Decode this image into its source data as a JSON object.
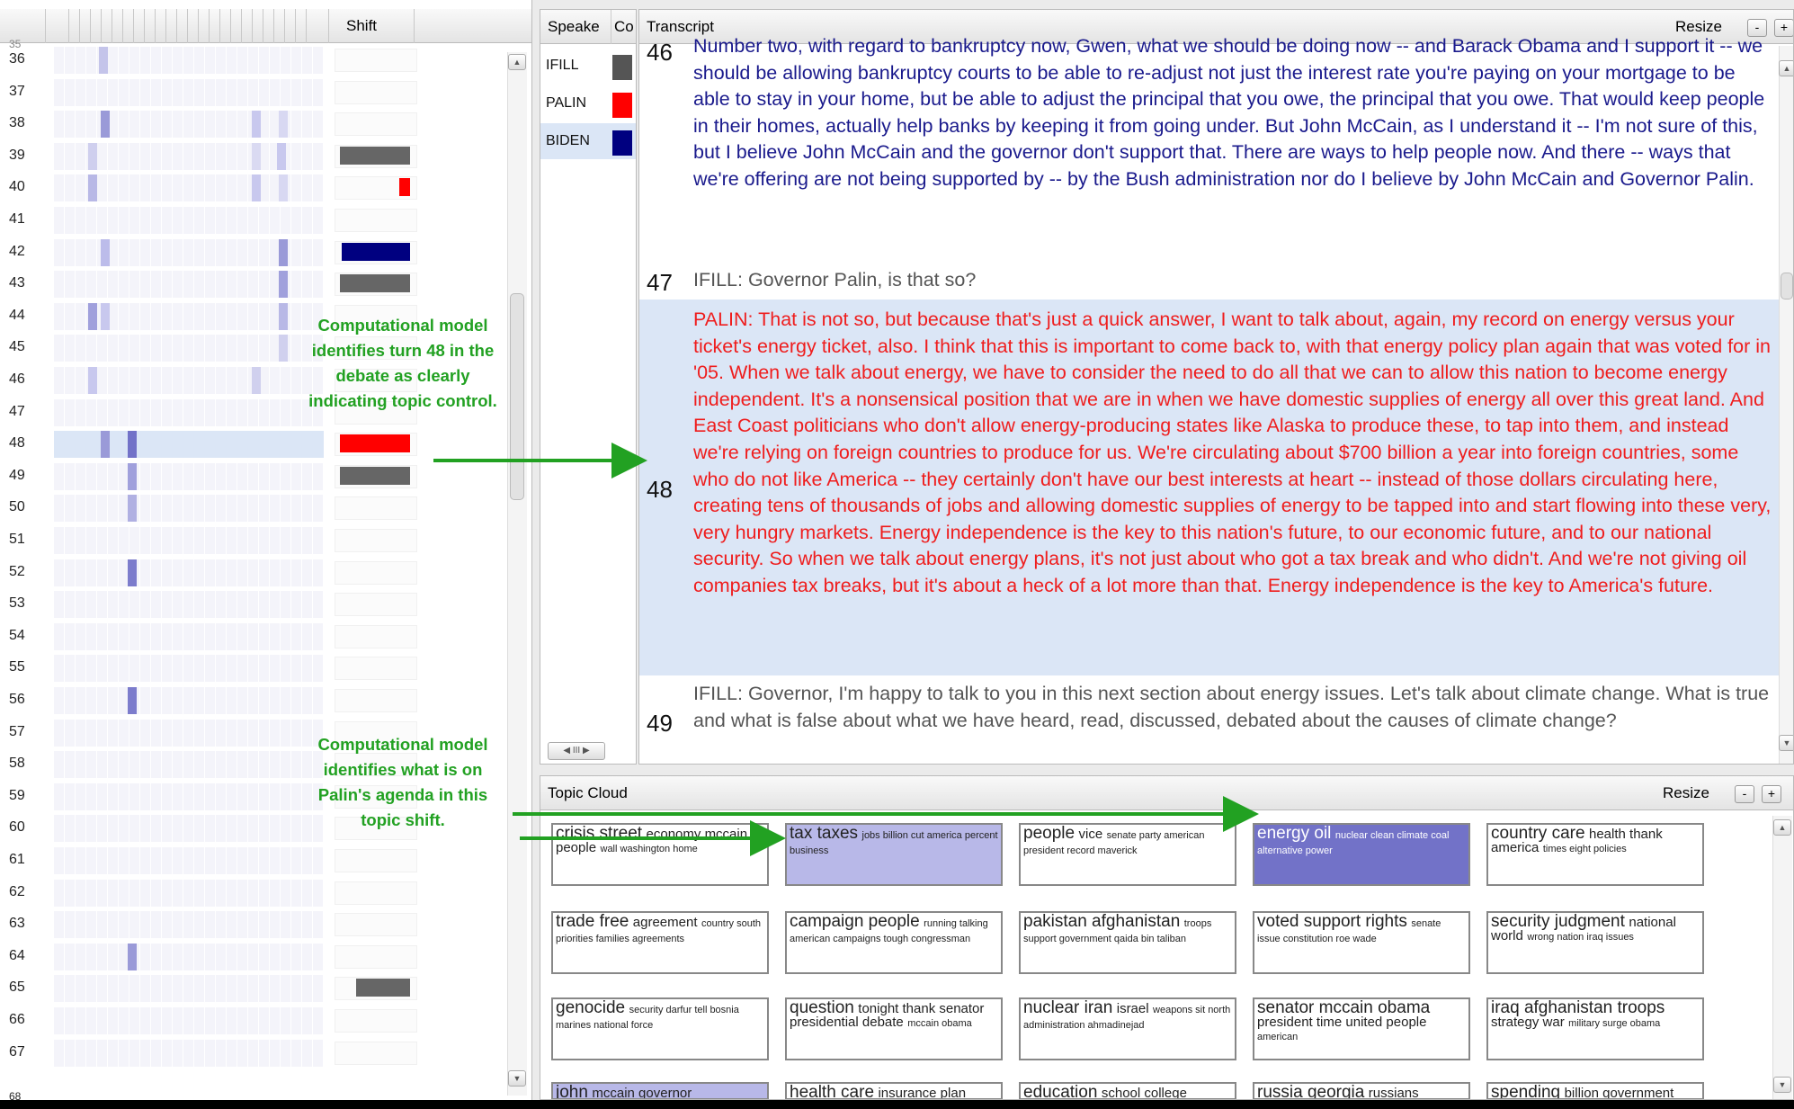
{
  "left_panel": {
    "header": "Shift",
    "rows": [
      "36",
      "37",
      "38",
      "39",
      "40",
      "41",
      "42",
      "43",
      "44",
      "45",
      "46",
      "47",
      "48",
      "49",
      "50",
      "51",
      "52",
      "53",
      "54",
      "55",
      "56",
      "57",
      "58",
      "59",
      "60",
      "61",
      "62",
      "63",
      "64",
      "65",
      "66",
      "67"
    ],
    "partial_top": "35",
    "partial_bottom": "68",
    "annotation_1": "Computational model identifies turn 48 in the debate as clearly indicating topic control.",
    "annotation_2": "Computational model identifies what is on Palin's agenda in this topic shift."
  },
  "speakers_panel": {
    "header_speaker": "Speake",
    "header_color": "Co",
    "speakers": [
      {
        "name": "IFILL",
        "color": "#555555"
      },
      {
        "name": "PALIN",
        "color": "#ff0000"
      },
      {
        "name": "BIDEN",
        "color": "#000080"
      }
    ],
    "scroll_mid": "III"
  },
  "transcript": {
    "title": "Transcript",
    "resize": "Resize",
    "minus": "-",
    "plus": "+",
    "turns": [
      {
        "num": "46",
        "text": "Number two, with regard to bankruptcy now, Gwen, what we should be doing now -- and Barack Obama and I support it -- we should be allowing bankruptcy courts to be able to re-adjust not just the interest rate you're paying on your mortgage to be able to stay in your home, but be able to adjust the principal that you owe, the principal that you owe. That would keep people in their homes, actually help banks by keeping it from going under. But John McCain, as I understand it -- I'm not sure of this, but I believe John McCain and the governor don't support that. There are ways to help people now. And there -- ways that we're offering are not being supported by -- by the Bush administration nor do I believe by John McCain and Governor Palin."
      },
      {
        "num": "47",
        "text": "IFILL: Governor Palin, is that so?"
      },
      {
        "num": "48",
        "text": "PALIN: That is not so, but because that's just a quick answer, I want to talk about, again, my record on energy versus your ticket's energy ticket, also. I think that this is important to come back to, with that energy policy plan again that was voted for in '05. When we talk about energy, we have to consider the need to do all that we can to allow this nation to become energy independent. It's a nonsensical position that we are in when we have domestic supplies of energy all over this great land. And East Coast politicians who don't allow energy-producing states like Alaska to produce these, to tap into them, and instead we're relying on foreign countries to produce for us. We're circulating about $700 billion a year into foreign countries, some who do not like America -- they certainly don't have our best interests at heart -- instead of those dollars circulating here, creating tens of thousands of jobs and allowing domestic supplies of energy to be tapped into and start flowing into these very, very hungry markets. Energy independence is the key to this nation's future, to our economic future, and to our national security. So when we talk about energy plans, it's not just about who got a tax break and who didn't. And we're not giving oil companies tax breaks, but it's about a heck of a lot more than that. Energy independence is the key to America's future."
      },
      {
        "num": "49",
        "text": "IFILL: Governor, I'm happy to talk to you in this next section about energy issues. Let's talk about climate change. What is true and what is false about what we have heard, read, discussed, debated about the causes of climate change?"
      }
    ]
  },
  "topic_cloud": {
    "title": "Topic Cloud",
    "resize": "Resize",
    "minus": "-",
    "plus": "+",
    "topics": [
      {
        "big": "crisis street",
        "mid": "economy mccain people",
        "small": "wall washington home"
      },
      {
        "big": "tax taxes",
        "mid": "",
        "small": "jobs billion cut america percent business"
      },
      {
        "big": "people",
        "mid": "vice",
        "small": "senate party american president record maverick"
      },
      {
        "big": "energy oil",
        "mid": "",
        "small": "nuclear clean climate coal alternative power"
      },
      {
        "big": "country care",
        "mid": "health thank america",
        "small": "times eight policies"
      },
      {
        "big": "trade free",
        "mid": "agreement",
        "small": "country south priorities families agreements"
      },
      {
        "big": "campaign people",
        "mid": "",
        "small": "running talking american campaigns tough congressman"
      },
      {
        "big": "pakistan afghanistan",
        "mid": "",
        "small": "troops support government qaida bin taliban"
      },
      {
        "big": "voted support rights",
        "mid": "",
        "small": "senate issue constitution roe wade"
      },
      {
        "big": "security judgment",
        "mid": "national world",
        "small": "wrong nation iraq issues"
      },
      {
        "big": "genocide",
        "mid": "",
        "small": "security darfur tell bosnia marines national force"
      },
      {
        "big": "question",
        "mid": "tonight thank senator presidential debate",
        "small": "mccain obama"
      },
      {
        "big": "nuclear iran",
        "mid": "israel",
        "small": "weapons sit north administration ahmadinejad"
      },
      {
        "big": "senator mccain obama",
        "mid": "president time united people",
        "small": "american"
      },
      {
        "big": "iraq afghanistan troops",
        "mid": "strategy war",
        "small": "military surge obama"
      },
      {
        "big": "john",
        "mid": "mccain governor",
        "small": ""
      },
      {
        "big": "health care",
        "mid": "insurance plan",
        "small": ""
      },
      {
        "big": "education",
        "mid": "school college",
        "small": ""
      },
      {
        "big": "russia georgia",
        "mid": "russians",
        "small": ""
      },
      {
        "big": "spending",
        "mid": "billion government",
        "small": ""
      }
    ]
  }
}
